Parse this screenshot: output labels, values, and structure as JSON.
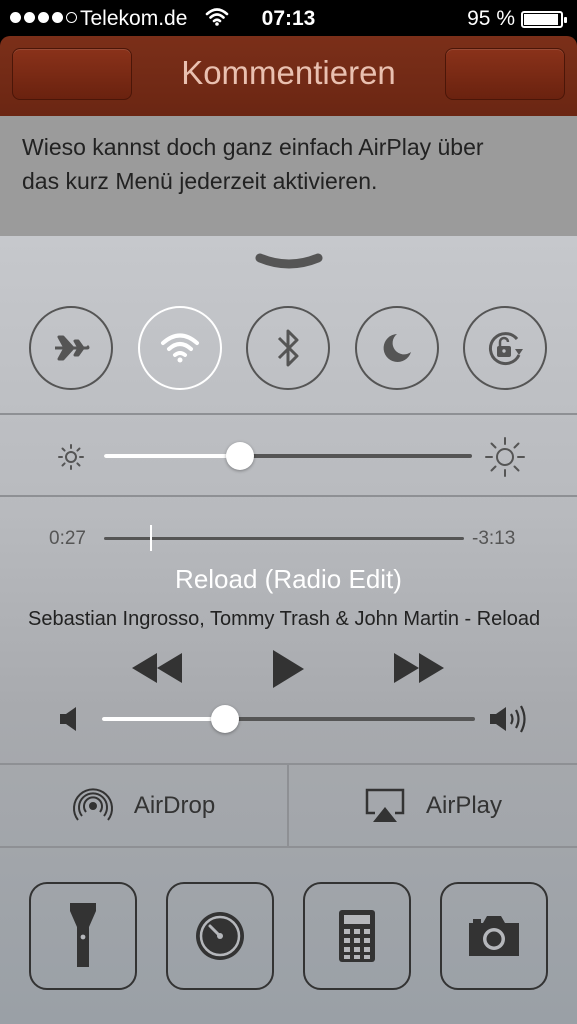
{
  "status_bar": {
    "carrier": "Telekom.de",
    "time": "07:13",
    "battery_percent": "95 %",
    "battery_level": 0.95,
    "signal_bars_filled": 4,
    "signal_bars_total": 5
  },
  "nav": {
    "title": "Kommentieren"
  },
  "comment": {
    "line1": "Wieso kannst doch ganz einfach AirPlay über",
    "line2": "das kurz Menü jederzeit aktivieren."
  },
  "control_center": {
    "toggles": [
      {
        "name": "airplane-mode",
        "icon": "airplane-icon",
        "active": false
      },
      {
        "name": "wifi",
        "icon": "wifi-icon",
        "active": true
      },
      {
        "name": "bluetooth",
        "icon": "bluetooth-icon",
        "active": false
      },
      {
        "name": "do-not-disturb",
        "icon": "moon-icon",
        "active": false
      },
      {
        "name": "rotation-lock",
        "icon": "rotation-lock-icon",
        "active": false
      }
    ],
    "brightness_level": 0.37,
    "player": {
      "elapsed": "0:27",
      "remaining": "-3:13",
      "progress": 0.13,
      "title": "Reload (Radio Edit)",
      "artist": "Sebastian Ingrosso, Tommy Trash & John Martin - Reload"
    },
    "volume_level": 0.33,
    "airdrop_label": "AirDrop",
    "airplay_label": "AirPlay",
    "tools": [
      {
        "name": "flashlight",
        "icon": "flashlight-icon"
      },
      {
        "name": "timer",
        "icon": "timer-icon"
      },
      {
        "name": "calculator",
        "icon": "calculator-icon"
      },
      {
        "name": "camera",
        "icon": "camera-icon"
      }
    ]
  }
}
